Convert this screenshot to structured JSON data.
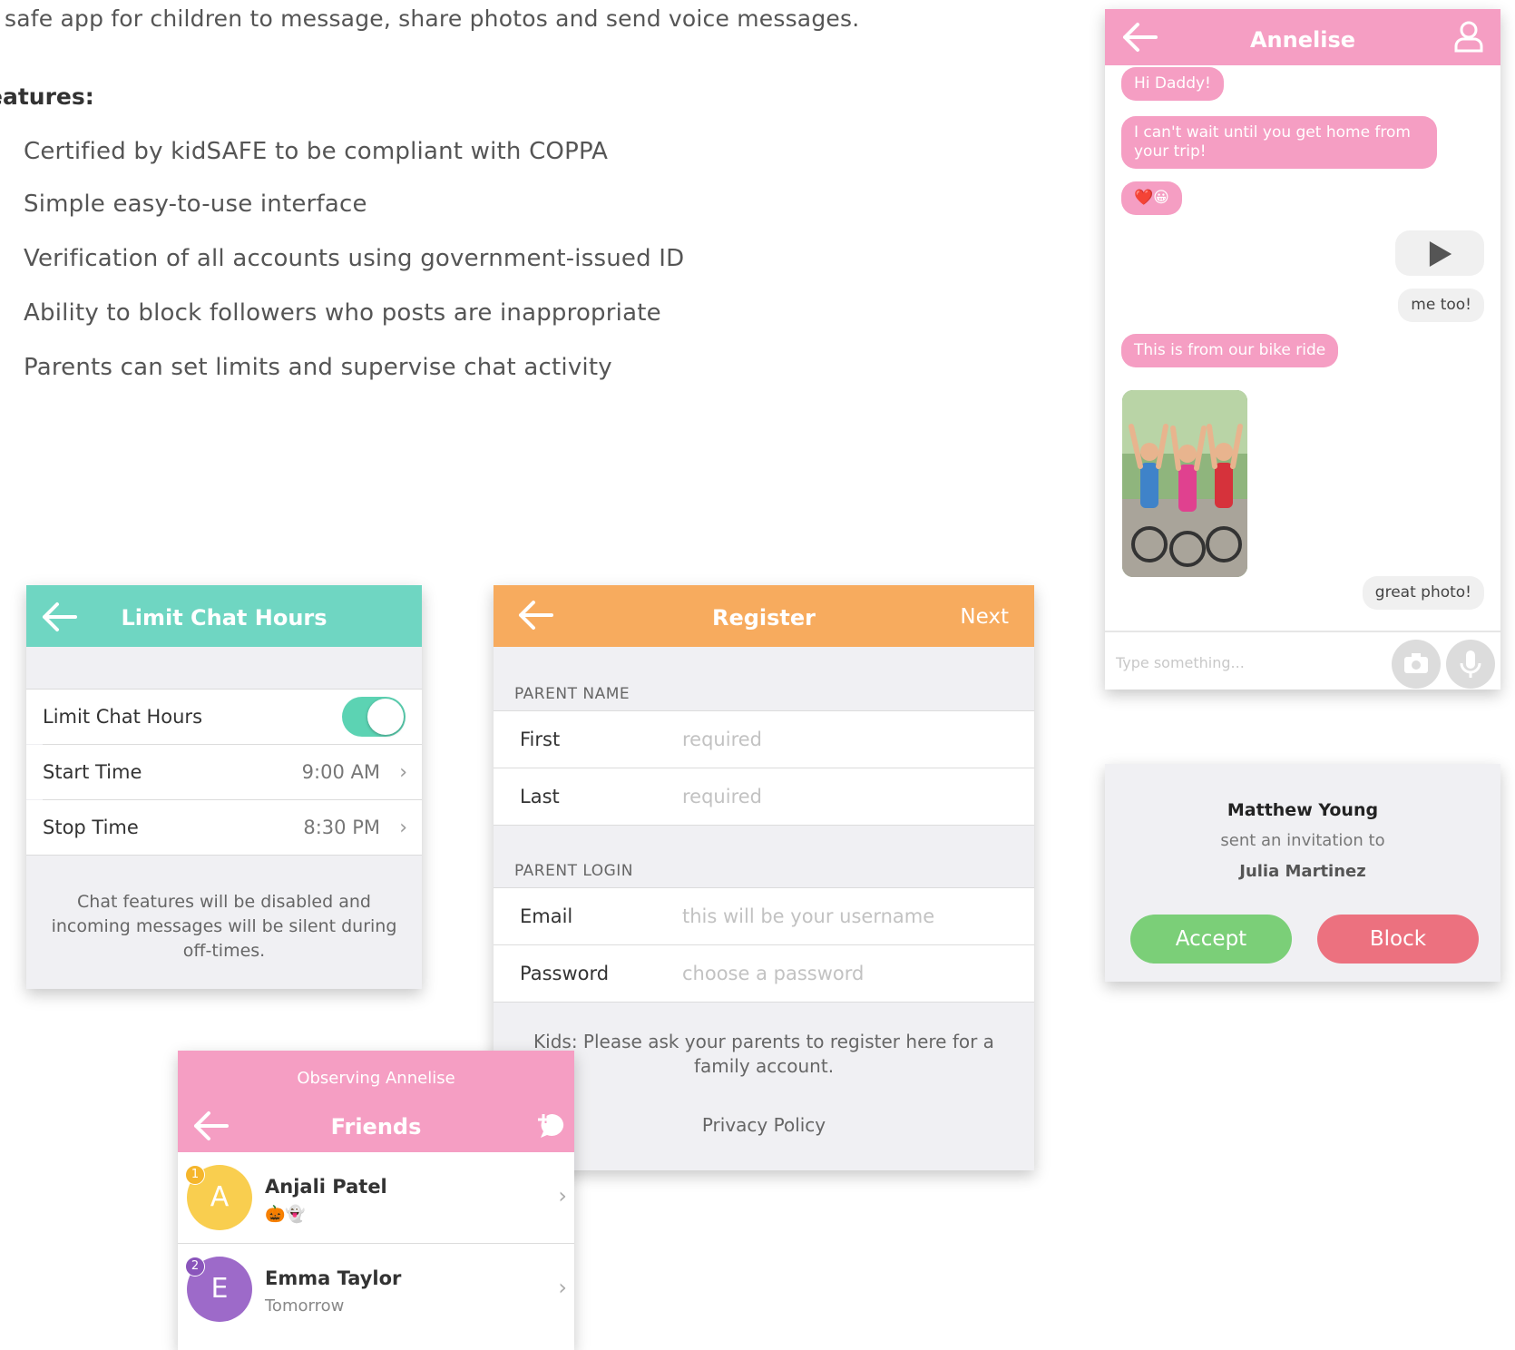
{
  "intro": {
    "text": "safe app for children to message, share photos and send voice messages.",
    "features_heading": "eatures:",
    "features": [
      "Certified by kidSAFE to be compliant with COPPA",
      "Simple easy-to-use interface",
      "Verification of all accounts using government-issued ID",
      " Ability to block followers who posts are inappropriate",
      "Parents can set limits and supervise chat activity"
    ]
  },
  "limit": {
    "title": "Limit Chat Hours",
    "toggle_label": "Limit Chat Hours",
    "toggle_on": true,
    "start_label": "Start Time",
    "start_value": "9:00 AM",
    "stop_label": "Stop Time",
    "stop_value": "8:30 PM",
    "note": "Chat features will be disabled and incoming messages will be silent during off-times.",
    "accent": "#6fd6c2"
  },
  "register": {
    "title": "Register",
    "next": "Next",
    "section_name": "PARENT NAME",
    "first_label": "First",
    "first_placeholder": "required",
    "last_label": "Last",
    "last_placeholder": "required",
    "section_login": "PARENT LOGIN",
    "email_label": "Email",
    "email_placeholder": "this will be your username",
    "password_label": "Password",
    "password_placeholder": "choose a password",
    "kids_note": "Kids: Please ask your parents to register here for a family account.",
    "privacy": "Privacy Policy",
    "accent": "#f7ab5e"
  },
  "friends": {
    "observing": "Observing Annelise",
    "title": "Friends",
    "list": [
      {
        "initial": "A",
        "name": "Anjali Patel",
        "sub": "🎃👻",
        "badge": "1",
        "color": "#f9ce4f",
        "badge_color": "#f5b62c"
      },
      {
        "initial": "E",
        "name": "Emma Taylor",
        "sub": "Tomorrow",
        "badge": "2",
        "color": "#9d6ac9",
        "badge_color": "#8a55bb"
      }
    ],
    "accent": "#f59ec3"
  },
  "chat": {
    "title": "Annelise",
    "messages": [
      {
        "from": "them",
        "text": "Hi Daddy!"
      },
      {
        "from": "them",
        "text": "I can't wait until you get home from your trip!"
      },
      {
        "from": "them",
        "text": "❤️😀"
      },
      {
        "from": "me",
        "text": "me too!"
      },
      {
        "from": "them",
        "text": "This is from our bike ride"
      },
      {
        "from": "me",
        "text": "great photo!"
      }
    ],
    "input_placeholder": "Type something...",
    "accent": "#f59ec3"
  },
  "invite": {
    "from": "Matthew Young",
    "action": "sent an invitation to",
    "to": "Julia Martinez",
    "accept": "Accept",
    "block": "Block",
    "accept_color": "#7bcf78",
    "block_color": "#ec717f"
  }
}
